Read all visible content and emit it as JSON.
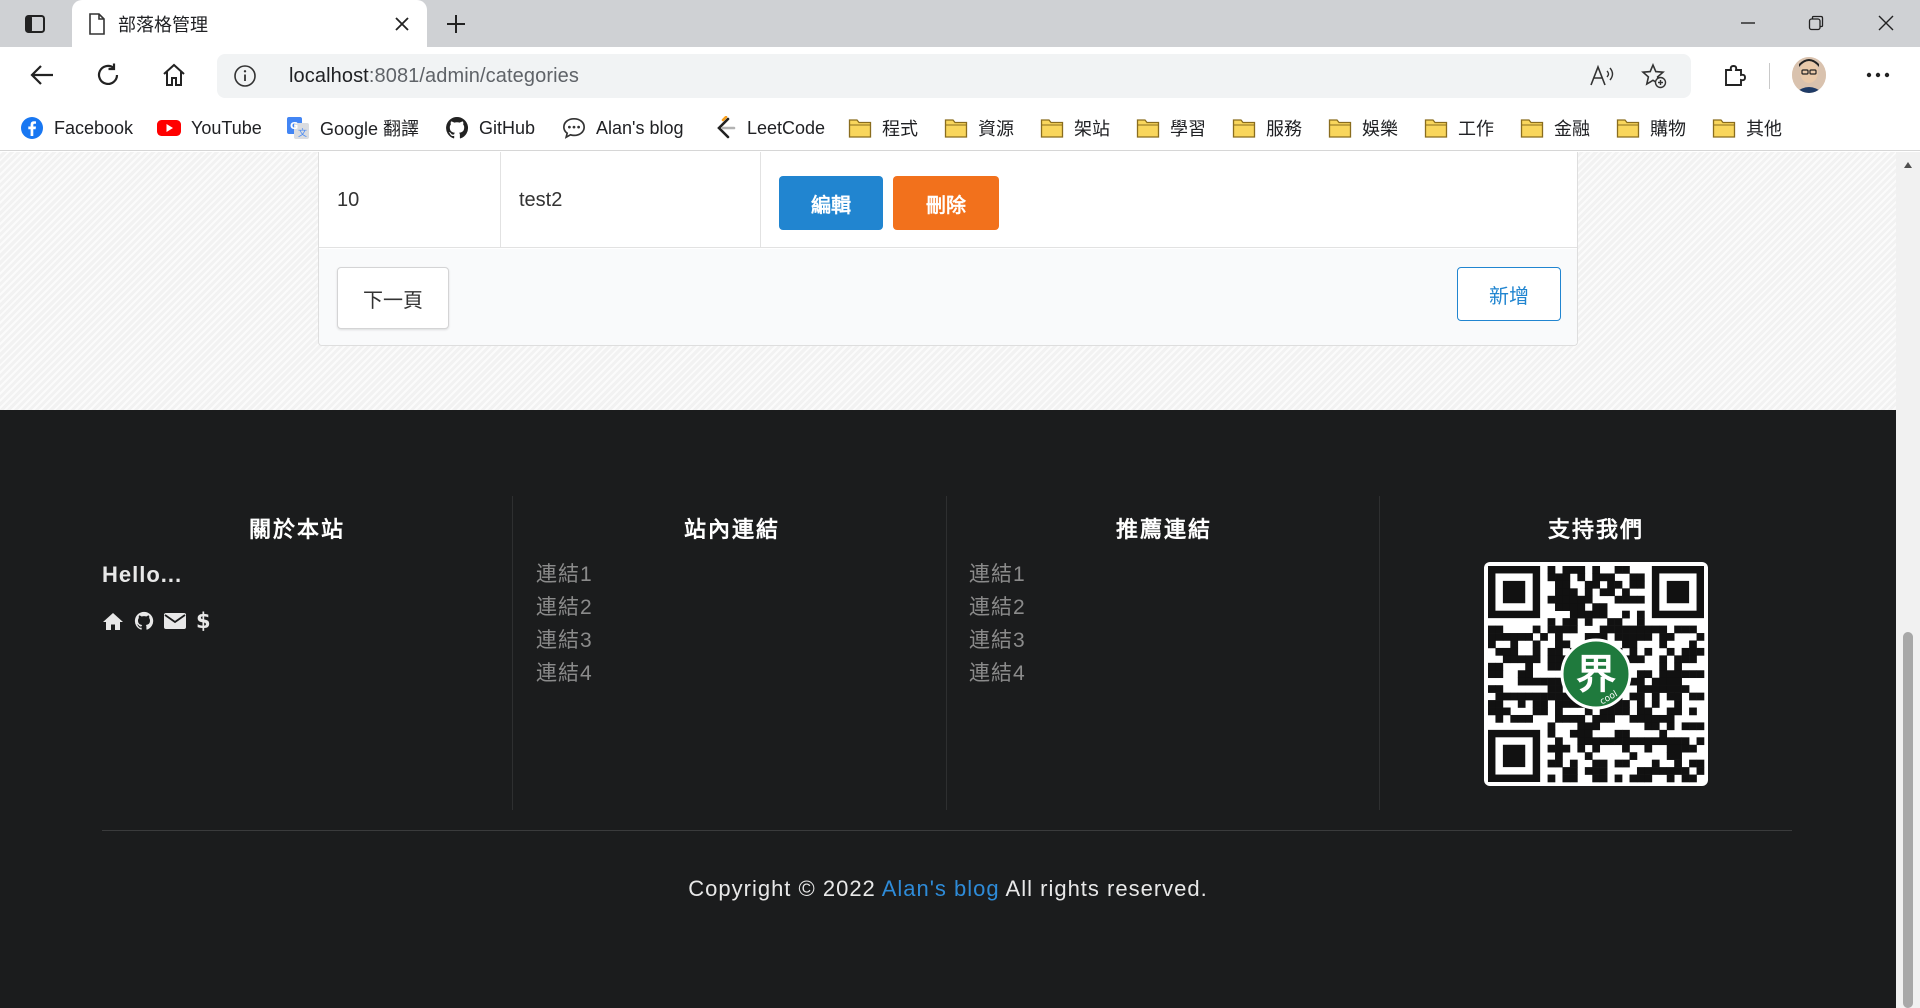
{
  "browser": {
    "tab_title": "部落格管理",
    "url_host": "localhost",
    "url_path": ":8081/admin/categories",
    "colors": {
      "tabstrip": "#cfd1d4",
      "omnibox": "#f1f3f4"
    }
  },
  "bookmarks": [
    {
      "label": "Facebook",
      "icon": "facebook-icon"
    },
    {
      "label": "YouTube",
      "icon": "youtube-icon"
    },
    {
      "label": "Google 翻譯",
      "icon": "google-translate-icon"
    },
    {
      "label": "GitHub",
      "icon": "github-icon"
    },
    {
      "label": "Alan's blog",
      "icon": "chat-bubble-icon"
    },
    {
      "label": "LeetCode",
      "icon": "leetcode-icon"
    },
    {
      "label": "程式",
      "icon": "folder-icon"
    },
    {
      "label": "資源",
      "icon": "folder-icon"
    },
    {
      "label": "架站",
      "icon": "folder-icon"
    },
    {
      "label": "學習",
      "icon": "folder-icon"
    },
    {
      "label": "服務",
      "icon": "folder-icon"
    },
    {
      "label": "娛樂",
      "icon": "folder-icon"
    },
    {
      "label": "工作",
      "icon": "folder-icon"
    },
    {
      "label": "金融",
      "icon": "folder-icon"
    },
    {
      "label": "購物",
      "icon": "folder-icon"
    },
    {
      "label": "其他",
      "icon": "folder-icon"
    }
  ],
  "table": {
    "row": {
      "id": "10",
      "name": "test2"
    },
    "edit_label": "編輯",
    "delete_label": "刪除",
    "next_label": "下一頁",
    "add_label": "新增",
    "colors": {
      "edit": "#2185d0",
      "delete": "#f2711c"
    }
  },
  "footer": {
    "about": {
      "title": "關於本站",
      "text": "Hello...",
      "icons": [
        "home-icon",
        "github-icon",
        "envelope-icon",
        "dollar-icon"
      ]
    },
    "internal": {
      "title": "站內連結",
      "links": [
        "連結1",
        "連結2",
        "連結3",
        "連結4"
      ]
    },
    "recommended": {
      "title": "推薦連結",
      "links": [
        "連結1",
        "連結2",
        "連結3",
        "連結4"
      ]
    },
    "support": {
      "title": "支持我們",
      "qr_badge": "界",
      "qr_badge_sub": "cool"
    },
    "copyright_prefix": "Copyright © 2022 ",
    "copyright_link": "Alan's blog",
    "copyright_suffix": " All rights reserved.",
    "colors": {
      "background": "#1b1c1d",
      "link": "#2e8bd8"
    }
  }
}
